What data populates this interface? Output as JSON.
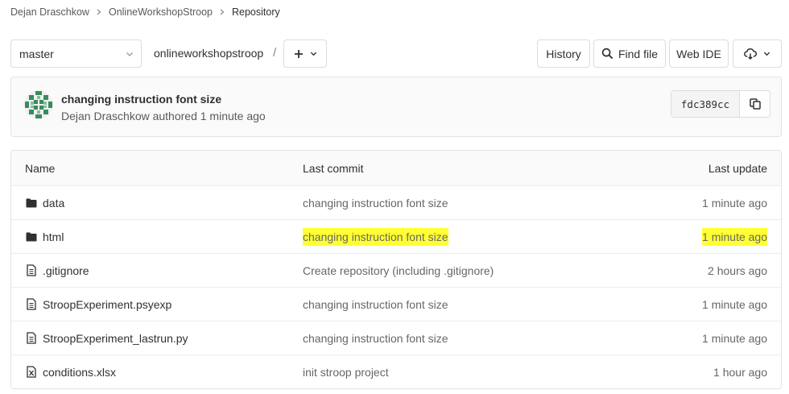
{
  "breadcrumb": {
    "user": "Dejan Draschkow",
    "project": "OnlineWorkshopStroop",
    "current": "Repository"
  },
  "toolbar": {
    "branch": "master",
    "path": "onlineworkshopstroop",
    "path_separator": "/",
    "history_label": "History",
    "find_file_label": "Find file",
    "web_ide_label": "Web IDE"
  },
  "commit": {
    "title": "changing instruction font size",
    "meta": "Dejan Draschkow authored 1 minute ago",
    "sha": "fdc389cc"
  },
  "table": {
    "headers": {
      "name": "Name",
      "last_commit": "Last commit",
      "last_update": "Last update"
    },
    "rows": [
      {
        "name": "data",
        "type": "folder",
        "commit": "changing instruction font size",
        "updated": "1 minute ago"
      },
      {
        "name": "html",
        "type": "folder",
        "commit": "changing instruction font size",
        "updated": "1 minute ago"
      },
      {
        "name": ".gitignore",
        "type": "file",
        "commit": "Create repository (including .gitignore)",
        "updated": "2 hours ago"
      },
      {
        "name": "StroopExperiment.psyexp",
        "type": "file",
        "commit": "changing instruction font size",
        "updated": "1 minute ago"
      },
      {
        "name": "StroopExperiment_lastrun.py",
        "type": "file",
        "commit": "changing instruction font size",
        "updated": "1 minute ago"
      },
      {
        "name": "conditions.xlsx",
        "type": "spreadsheet",
        "commit": "init stroop project",
        "updated": "1 hour ago"
      }
    ]
  },
  "icons": {
    "breadcrumb_separator": "chevron-right-icon",
    "branch_dropdown": "chevron-down-icon",
    "add": "plus-icon",
    "find": "search-icon",
    "download": "cloud-download-icon",
    "copy": "copy-icon",
    "folder": "folder-icon",
    "file": "file-icon",
    "spreadsheet": "spreadsheet-file-icon"
  },
  "colors": {
    "highlight": "#ffff33",
    "border": "#e3e3e3",
    "muted_text": "#666666",
    "avatar": "#3a8a5c"
  }
}
